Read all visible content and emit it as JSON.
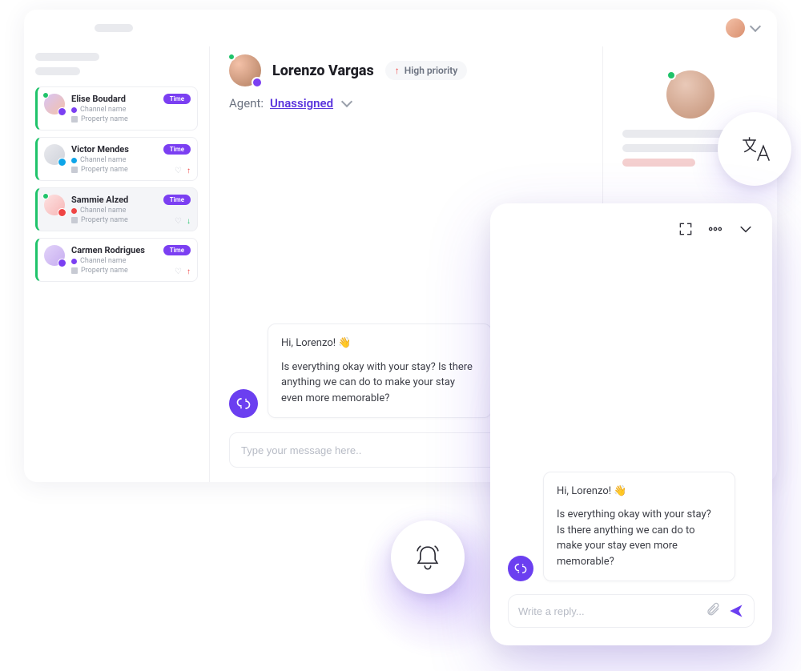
{
  "topbar": {
    "user_menu_label": ""
  },
  "sidebar": {
    "channel_label": "Channel name",
    "property_label": "Property name",
    "time_label": "Time",
    "conversations": [
      {
        "name": "Elise Boudard",
        "channel_color": "#7b3ff2"
      },
      {
        "name": "Victor Mendes",
        "channel_color": "#0ea5e9"
      },
      {
        "name": "Sammie Alzed",
        "channel_color": "#ef4444"
      },
      {
        "name": "Carmen Rodrigues",
        "channel_color": "#7b3ff2"
      }
    ]
  },
  "thread": {
    "customer_name": "Lorenzo Vargas",
    "priority_label": "High priority",
    "agent_label": "Agent:",
    "agent_value": "Unassigned",
    "message_greeting": "Hi, Lorenzo! 👋",
    "message_body": "Is everything okay with your stay? Is there anything we can do to make your stay even more memorable?",
    "composer_placeholder": "Type your message here.."
  },
  "mobile": {
    "message_greeting": "Hi, Lorenzo! 👋",
    "message_body": "Is everything okay with your stay? Is there anything we can do to make your stay even more memorable?",
    "composer_placeholder": "Write a reply..."
  },
  "colors": {
    "accent": "#6b3ff0",
    "success": "#1fc36a",
    "danger": "#ef4444"
  }
}
